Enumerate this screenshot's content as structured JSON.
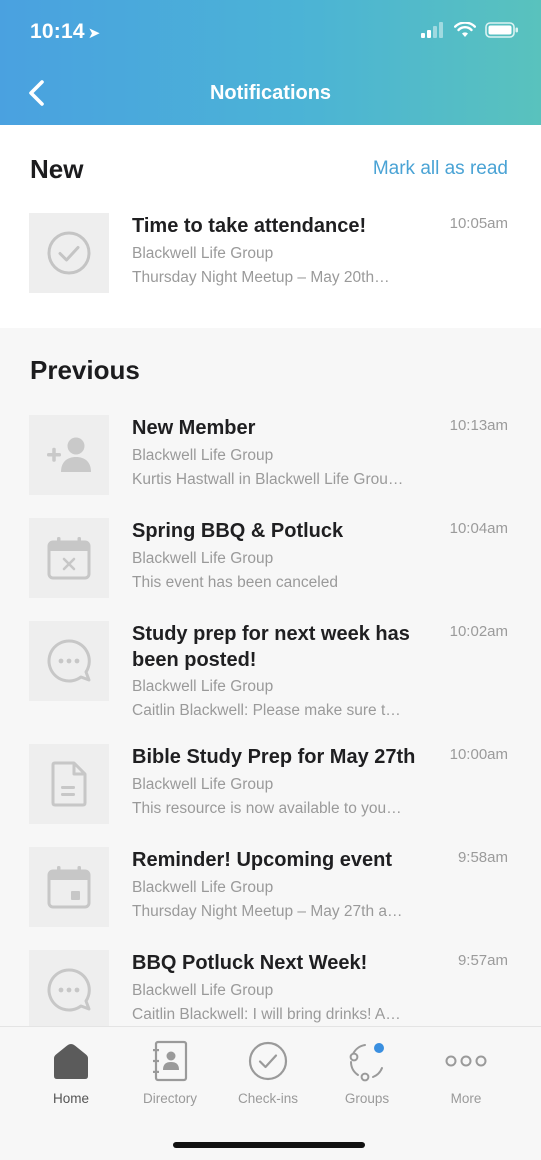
{
  "status_bar": {
    "time": "10:14",
    "location_icon": "location-arrow-icon"
  },
  "nav": {
    "title": "Notifications",
    "back_icon": "chevron-left-icon"
  },
  "new_section": {
    "title": "New",
    "mark_all_label": "Mark all as read",
    "items": [
      {
        "icon": "check-circle-icon",
        "title": "Time to take attendance!",
        "time": "10:05am",
        "group": "Blackwell Life Group",
        "detail": "Thursday Night Meetup – May 20th…"
      }
    ]
  },
  "previous_section": {
    "title": "Previous",
    "items": [
      {
        "icon": "add-person-icon",
        "title": "New Member",
        "time": "10:13am",
        "group": "Blackwell Life Group",
        "detail": "Kurtis Hastwall in Blackwell Life Grou…"
      },
      {
        "icon": "calendar-cancel-icon",
        "title": "Spring BBQ & Potluck",
        "time": "10:04am",
        "group": "Blackwell Life Group",
        "detail": "This event has been canceled"
      },
      {
        "icon": "chat-bubble-icon",
        "title": "Study prep for next week has been posted!",
        "time": "10:02am",
        "group": "Blackwell Life Group",
        "detail": "Caitlin Blackwell: Please make sure t…"
      },
      {
        "icon": "document-icon",
        "title": "Bible Study Prep for May 27th",
        "time": "10:00am",
        "group": "Blackwell Life Group",
        "detail": "This resource is now available to you…"
      },
      {
        "icon": "calendar-event-icon",
        "title": "Reminder! Upcoming event",
        "time": "9:58am",
        "group": "Blackwell Life Group",
        "detail": "Thursday Night Meetup – May 27th a…"
      },
      {
        "icon": "chat-bubble-icon",
        "title": "BBQ Potluck Next Week!",
        "time": "9:57am",
        "group": "Blackwell Life Group",
        "detail": "Caitlin Blackwell: I will bring drinks! A…"
      }
    ]
  },
  "tabbar": {
    "active": "Home",
    "tabs": [
      {
        "label": "Home",
        "icon": "home-icon"
      },
      {
        "label": "Directory",
        "icon": "contact-book-icon"
      },
      {
        "label": "Check-ins",
        "icon": "check-circle-icon"
      },
      {
        "label": "Groups",
        "icon": "groups-icon"
      },
      {
        "label": "More",
        "icon": "more-dots-icon"
      }
    ]
  },
  "colors": {
    "header_start": "#4aa1e0",
    "header_end": "#59c2bd",
    "accent": "#4aa3d5",
    "groups_badge": "#3a8fe0"
  }
}
